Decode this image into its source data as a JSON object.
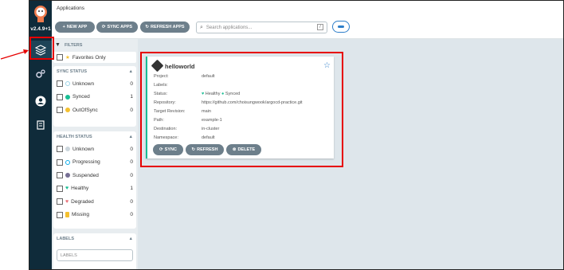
{
  "sidebar": {
    "version": "v2.4.9+1"
  },
  "header": {
    "title": "Applications",
    "buttons": {
      "new_app": "NEW APP",
      "sync_apps": "SYNC APPS",
      "refresh_apps": "REFRESH APPS"
    },
    "search_placeholder": "Search applications...",
    "search_shortcut": "/"
  },
  "filters": {
    "title": "FILTERS",
    "favorites_label": "Favorites Only",
    "sync_status": {
      "title": "SYNC STATUS",
      "items": [
        {
          "label": "Unknown",
          "count": "0"
        },
        {
          "label": "Synced",
          "count": "1"
        },
        {
          "label": "OutOfSync",
          "count": "0"
        }
      ]
    },
    "health_status": {
      "title": "HEALTH STATUS",
      "items": [
        {
          "label": "Unknown",
          "count": "0"
        },
        {
          "label": "Progressing",
          "count": "0"
        },
        {
          "label": "Suspended",
          "count": "0"
        },
        {
          "label": "Healthy",
          "count": "1"
        },
        {
          "label": "Degraded",
          "count": "0"
        },
        {
          "label": "Missing",
          "count": "0"
        }
      ]
    },
    "labels": {
      "title": "LABELS",
      "placeholder": "LABELS"
    }
  },
  "app_card": {
    "name": "helloworld",
    "fields": [
      {
        "key": "Project:",
        "value": "default"
      },
      {
        "key": "Labels:",
        "value": ""
      },
      {
        "key": "Status:",
        "value": ""
      },
      {
        "key": "Repository:",
        "value": "https://github.com/choisungwook/argocd-practice.git"
      },
      {
        "key": "Target Revision:",
        "value": "main"
      },
      {
        "key": "Path:",
        "value": "example-1"
      },
      {
        "key": "Destination:",
        "value": "in-cluster"
      },
      {
        "key": "Namespace:",
        "value": "default"
      }
    ],
    "health": "Healthy",
    "sync": "Synced",
    "buttons": {
      "sync": "SYNC",
      "refresh": "REFRESH",
      "delete": "DELETE"
    }
  },
  "colors": {
    "healthy": "#18be94",
    "synced": "#18be94",
    "outofsync": "#f4c030",
    "degraded": "#e96d76",
    "progressing": "#0dadea",
    "suspended": "#766f94",
    "missing": "#f4c030",
    "highlight": "#e60000"
  }
}
